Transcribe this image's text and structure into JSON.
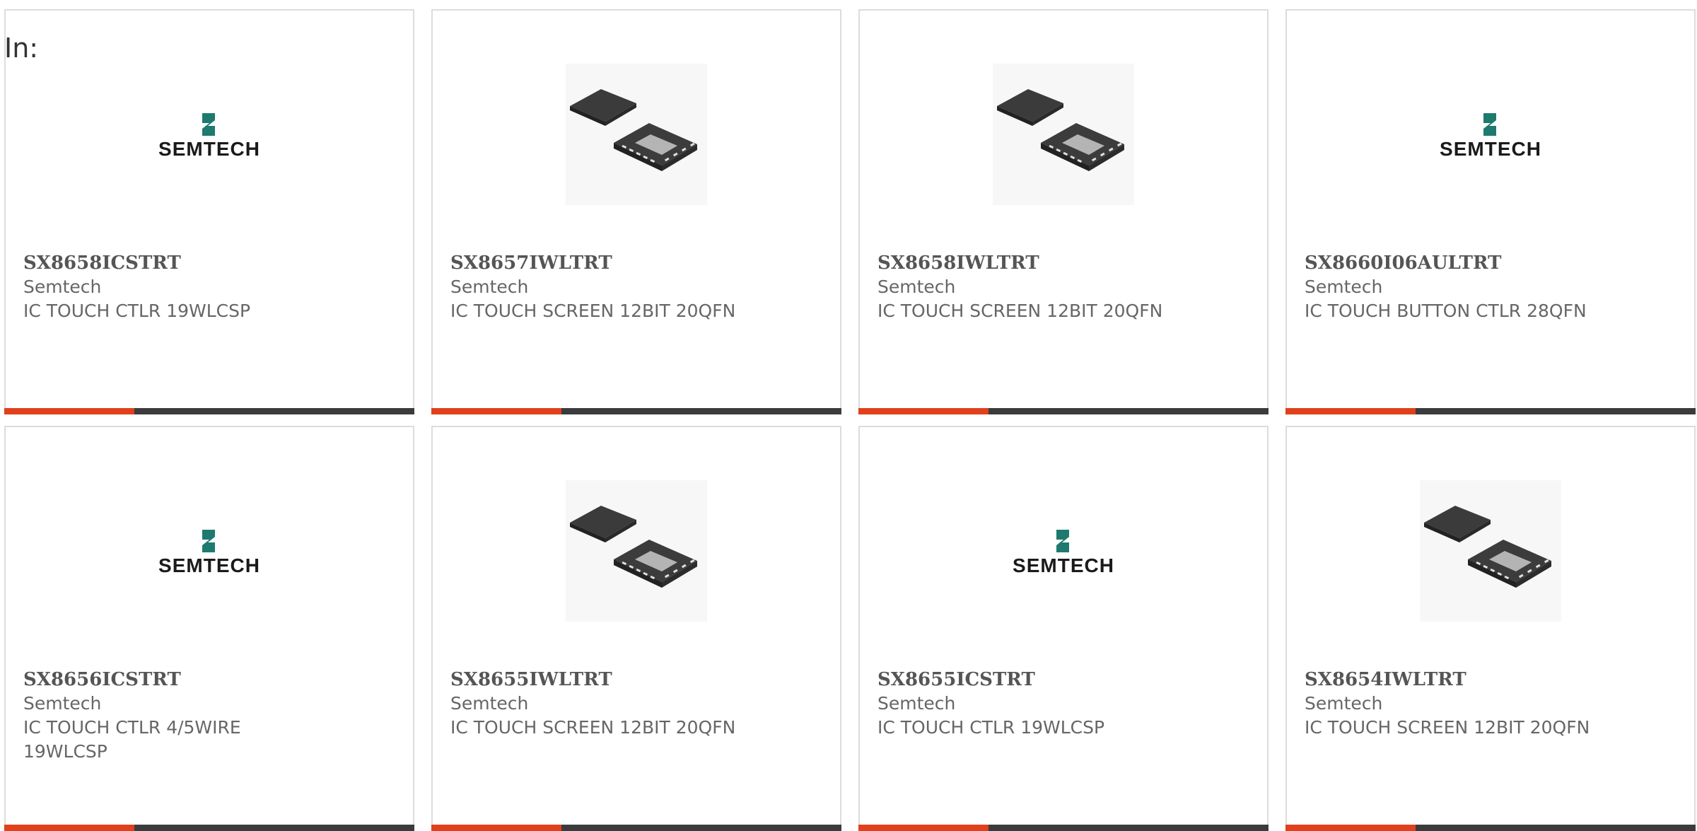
{
  "header": {
    "label": "In:"
  },
  "colors": {
    "accent_bar": "#e0401b",
    "bar": "#3a3b3d",
    "card_border": "#dcdcdc",
    "text": "#666666",
    "semtech_logo_text": "#1a1a1a",
    "semtech_logo_mark": "#1e7a6e"
  },
  "products": [
    {
      "part_number": "SX8658ICSTRT",
      "manufacturer": "Semtech",
      "description": "IC TOUCH CTLR 19WLCSP",
      "image": "semtech-logo",
      "logo_text": "SEMTECH"
    },
    {
      "part_number": "SX8657IWLTRT",
      "manufacturer": "Semtech",
      "description": "IC TOUCH SCREEN 12BIT 20QFN",
      "image": "qfn-chip-photo"
    },
    {
      "part_number": "SX8658IWLTRT",
      "manufacturer": "Semtech",
      "description": "IC TOUCH SCREEN 12BIT 20QFN",
      "image": "qfn-chip-photo"
    },
    {
      "part_number": "SX8660I06AULTRT",
      "manufacturer": "Semtech",
      "description": "IC TOUCH BUTTON CTLR 28QFN",
      "image": "semtech-logo",
      "logo_text": "SEMTECH"
    },
    {
      "part_number": "SX8656ICSTRT",
      "manufacturer": "Semtech",
      "description": "IC TOUCH CTLR 4/5WIRE 19WLCSP",
      "image": "semtech-logo",
      "logo_text": "SEMTECH"
    },
    {
      "part_number": "SX8655IWLTRT",
      "manufacturer": "Semtech",
      "description": "IC TOUCH SCREEN 12BIT 20QFN",
      "image": "qfn-chip-photo"
    },
    {
      "part_number": "SX8655ICSTRT",
      "manufacturer": "Semtech",
      "description": "IC TOUCH CTLR 19WLCSP",
      "image": "semtech-logo",
      "logo_text": "SEMTECH"
    },
    {
      "part_number": "SX8654IWLTRT",
      "manufacturer": "Semtech",
      "description": "IC TOUCH SCREEN 12BIT 20QFN",
      "image": "qfn-chip-photo"
    }
  ]
}
